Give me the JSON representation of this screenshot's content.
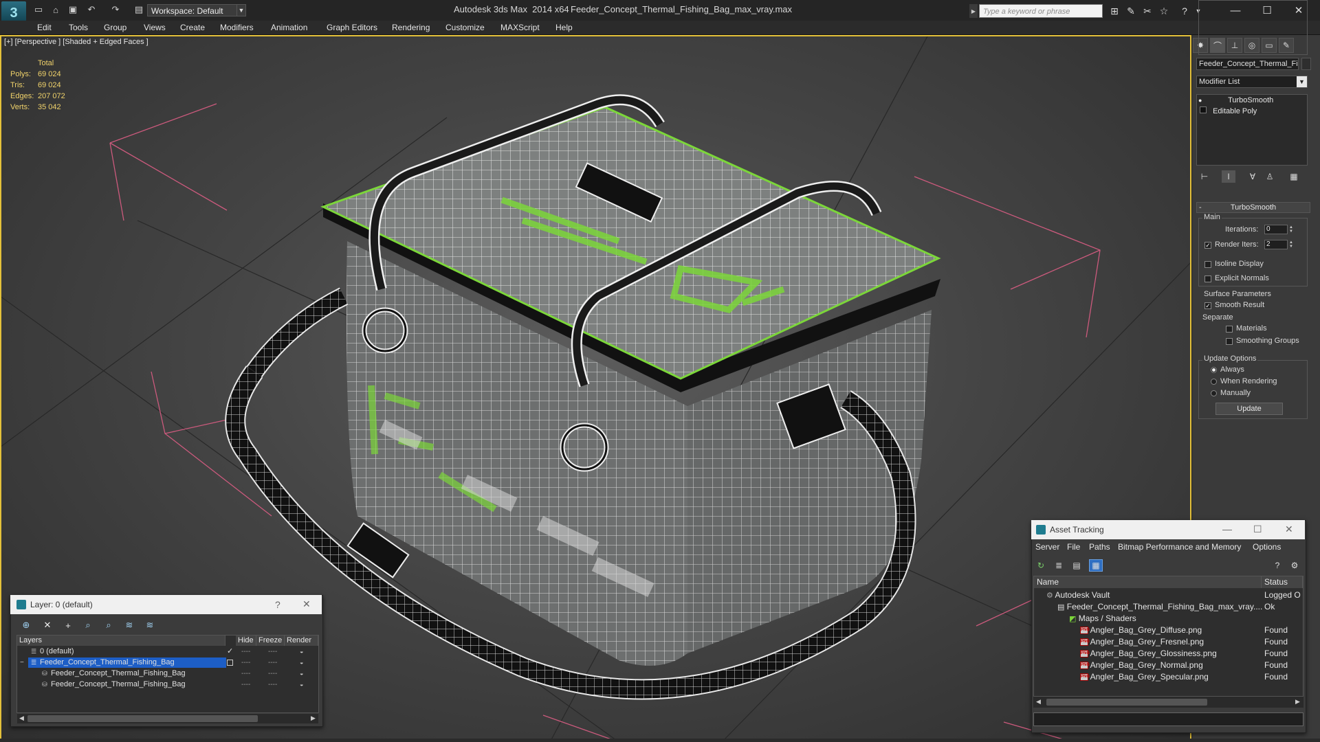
{
  "window": {
    "app_title": "Autodesk 3ds Max  2014 x64",
    "document_title": "Feeder_Concept_Thermal_Fishing_Bag_max_vray.max",
    "search_placeholder": "Type a keyword or phrase",
    "workspace": "Workspace: Default"
  },
  "menu": [
    "Edit",
    "Tools",
    "Group",
    "Views",
    "Create",
    "Modifiers",
    "Animation",
    "Graph Editors",
    "Rendering",
    "Customize",
    "MAXScript",
    "Help"
  ],
  "viewport": {
    "label": "[+] [Perspective ] [Shaded + Edged Faces ]",
    "stats_header": "Total",
    "stats": [
      {
        "label": "Polys:",
        "value": "69 024"
      },
      {
        "label": "Tris:",
        "value": "69 024"
      },
      {
        "label": "Edges:",
        "value": "207 072"
      },
      {
        "label": "Verts:",
        "value": "35 042"
      }
    ]
  },
  "command_panel": {
    "object_name": "Feeder_Concept_Thermal_Fis",
    "modifier_list": "Modifier List",
    "stack": [
      "TurboSmooth",
      "Editable Poly"
    ],
    "rollout_title": "TurboSmooth",
    "main_group": "Main",
    "iterations_label": "Iterations:",
    "iterations_value": "0",
    "render_iters_label": "Render Iters:",
    "render_iters_value": "2",
    "isoline_display": "Isoline Display",
    "explicit_normals": "Explicit Normals",
    "surface_params": "Surface Parameters",
    "smooth_result": "Smooth Result",
    "separate": "Separate",
    "materials": "Materials",
    "smoothing_groups": "Smoothing Groups",
    "update_options": "Update Options",
    "always": "Always",
    "when_rendering": "When Rendering",
    "manually": "Manually",
    "update_button": "Update"
  },
  "layer_dialog": {
    "title": "Layer: 0 (default)",
    "help": "?",
    "columns": [
      "Layers",
      "Hide",
      "Freeze",
      "Render"
    ],
    "rows": [
      {
        "name": "0 (default)",
        "level": 0
      },
      {
        "name": "Feeder_Concept_Thermal_Fishing_Bag",
        "level": 0
      },
      {
        "name": "Feeder_Concept_Thermal_Fishing_Bag",
        "level": 1
      },
      {
        "name": "Feeder_Concept_Thermal_Fishing_Bag",
        "level": 1
      }
    ],
    "dash": "----"
  },
  "asset_tracking": {
    "title": "Asset Tracking",
    "menu": [
      "Server",
      "File",
      "Paths",
      "Bitmap Performance and Memory",
      "Options"
    ],
    "columns": [
      "Name",
      "Status"
    ],
    "rows": [
      {
        "name": "Autodesk Vault",
        "status": "Logged O"
      },
      {
        "name": "Feeder_Concept_Thermal_Fishing_Bag_max_vray....",
        "status": "Ok"
      },
      {
        "name": "Maps / Shaders",
        "status": ""
      },
      {
        "name": "Angler_Bag_Grey_Diffuse.png",
        "status": "Found"
      },
      {
        "name": "Angler_Bag_Grey_Fresnel.png",
        "status": "Found"
      },
      {
        "name": "Angler_Bag_Grey_Glossiness.png",
        "status": "Found"
      },
      {
        "name": "Angler_Bag_Grey_Normal.png",
        "status": "Found"
      },
      {
        "name": "Angler_Bag_Grey_Specular.png",
        "status": "Found"
      }
    ]
  },
  "icons": {
    "app_logo": "3ds-max-logo-icon",
    "new": "new-file-icon",
    "open": "open-file-icon",
    "save": "save-icon",
    "undo": "undo-icon",
    "redo": "redo-icon",
    "binoculars": "binoculars-icon",
    "star": "favorites-icon",
    "help": "help-icon"
  },
  "colors": {
    "viewport_border": "#e4c13a",
    "stats_text": "#f1d36b",
    "selection": "#1d5ec6",
    "wire_green": "#7cd63a"
  }
}
